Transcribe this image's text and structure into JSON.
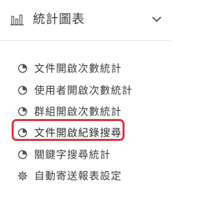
{
  "header": {
    "title": "統計圖表",
    "icon": "bar-chart-icon",
    "toggle_icon": "chevron-down-icon"
  },
  "menu": {
    "items": [
      {
        "label": "文件開啟次數統計",
        "icon": "pie-chart-icon",
        "active": false
      },
      {
        "label": "使用者開啟次數統計",
        "icon": "pie-chart-icon",
        "active": false
      },
      {
        "label": "群組開啟次數統計",
        "icon": "pie-chart-icon",
        "active": false
      },
      {
        "label": "文件開啟紀錄搜尋",
        "icon": "pie-chart-icon",
        "active": true
      },
      {
        "label": "關鍵字搜尋統計",
        "icon": "pie-chart-icon",
        "active": false
      },
      {
        "label": "自動寄送報表設定",
        "icon": "gear-icon",
        "active": false
      }
    ]
  },
  "colors": {
    "highlight_border": "#e0333f",
    "divider": "#e3e3e3",
    "text": "#3b3b3b"
  }
}
